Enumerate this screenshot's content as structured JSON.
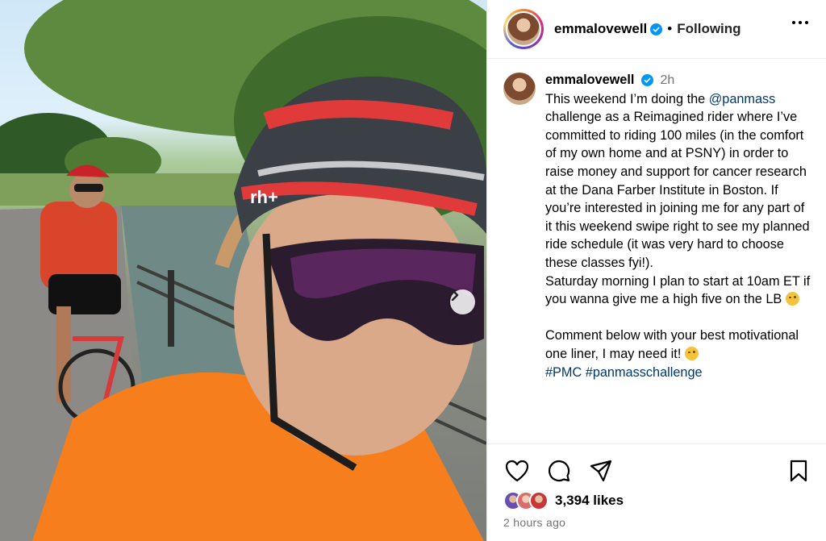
{
  "header": {
    "username": "emmalovewell",
    "separator": "•",
    "follow_status": "Following"
  },
  "caption": {
    "username": "emmalovewell",
    "time_ago": "2h",
    "text_before_mention": "This weekend I’m doing the ",
    "mention": "@panmass",
    "text_after_mention": " challenge as a Reimagined rider where I’ve committed to riding 100 miles (in the comfort of my own home and at PSNY) in order to raise money and support for cancer research at the Dana Farber Institute in Boston. If you’re interested in joining me for any part of it this weekend swipe right to see my planned ride schedule (it was very hard to choose these classes fyi!).\nSaturday morning I plan to start at 10am ET if you wanna give me a high five on the LB ",
    "text_comment": "\n\nComment below with your best motivational one liner, I may need it! ",
    "hashtags": "#PMC #panmasschallenge"
  },
  "photo": {
    "jersey_brand": "rh+"
  },
  "stats": {
    "likes": "3,394 likes",
    "posted": "2 hours ago"
  },
  "colors": {
    "verified": "#0095f6",
    "link": "#00376b",
    "muted": "#737373"
  },
  "icons": [
    "heart-icon",
    "comment-icon",
    "share-icon",
    "bookmark-icon",
    "chevron-right-icon",
    "more-icon",
    "verified-icon"
  ]
}
